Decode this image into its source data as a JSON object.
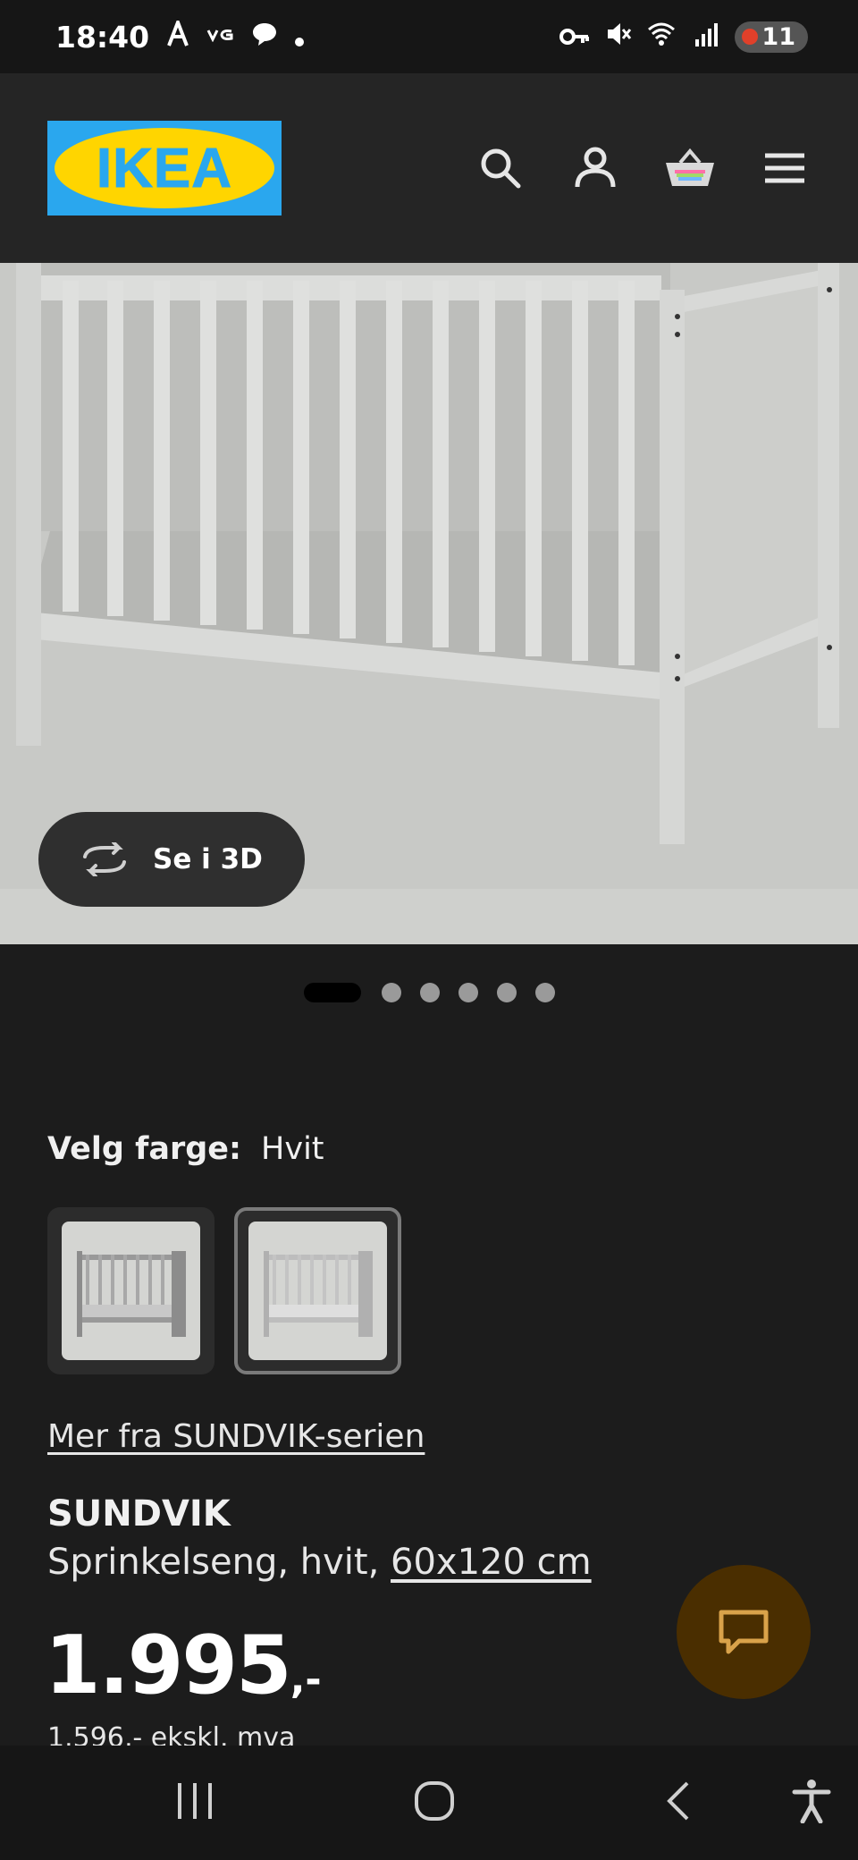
{
  "status_bar": {
    "time": "18:40",
    "left_icons": [
      "font-a-icon",
      "vg-icon",
      "chat-bubble-icon",
      "dot-icon"
    ],
    "right_icons": [
      "key-icon",
      "mute-icon",
      "wifi-6e-icon",
      "signal-icon"
    ],
    "battery_level": "11"
  },
  "header": {
    "logo_text": "IKEA",
    "icons": [
      "search-icon",
      "user-icon",
      "basket-icon",
      "menu-icon"
    ],
    "colors": {
      "logo_blue": "#2aa7ee",
      "logo_yellow": "#ffd500"
    }
  },
  "gallery": {
    "view_3d_label": "Se i 3D",
    "slide_count": 6,
    "active_slide": 1
  },
  "product": {
    "color_label": "Velg farge:",
    "color_value": "Hvit",
    "swatches": [
      {
        "color": "grey",
        "selected": false
      },
      {
        "color": "white",
        "selected": true
      }
    ],
    "series_link": "Mer fra SUNDVIK-serien",
    "name": "SUNDVIK",
    "description": "Sprinkelseng, hvit, ",
    "size": "60x120 cm",
    "price_main": "1.995",
    "price_suffix": ",-",
    "price_ex_vat": "1.596,- ekskl. mva"
  },
  "chat": {
    "icon": "chat-icon",
    "color": "#4a2e00"
  },
  "nav_bar": {
    "icons": [
      "recents-icon",
      "home-icon",
      "back-icon",
      "accessibility-icon"
    ]
  }
}
